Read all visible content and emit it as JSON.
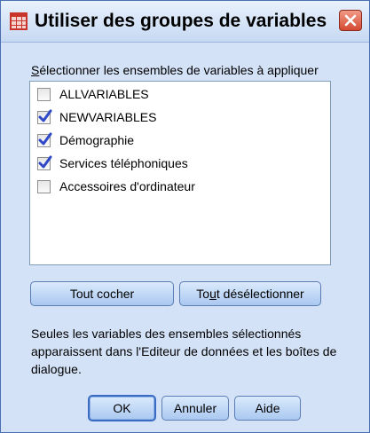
{
  "window": {
    "title": "Utiliser des groupes de variables"
  },
  "group": {
    "label_first": "S",
    "label_rest": "électionner les ensembles de variables à appliquer"
  },
  "list": {
    "items": [
      {
        "label": "ALLVARIABLES",
        "checked": false
      },
      {
        "label": "NEWVARIABLES",
        "checked": true
      },
      {
        "label": "Démographie",
        "checked": true
      },
      {
        "label": "Services téléphoniques",
        "checked": true
      },
      {
        "label": "Accessoires d'ordinateur",
        "checked": false
      }
    ]
  },
  "buttons": {
    "select_all": "Tout cocher",
    "deselect_all_pre": "To",
    "deselect_all_mnemonic": "u",
    "deselect_all_post": "t désélectionner",
    "ok": "OK",
    "cancel": "Annuler",
    "help": "Aide"
  },
  "info": {
    "text": "Seules les variables des ensembles sélectionnés apparaissent dans l'Editeur de données et les boîtes de dialogue."
  },
  "colors": {
    "accent": "#2e48c8",
    "close": "#d44a32",
    "titlebar": "#c6d9f3"
  }
}
